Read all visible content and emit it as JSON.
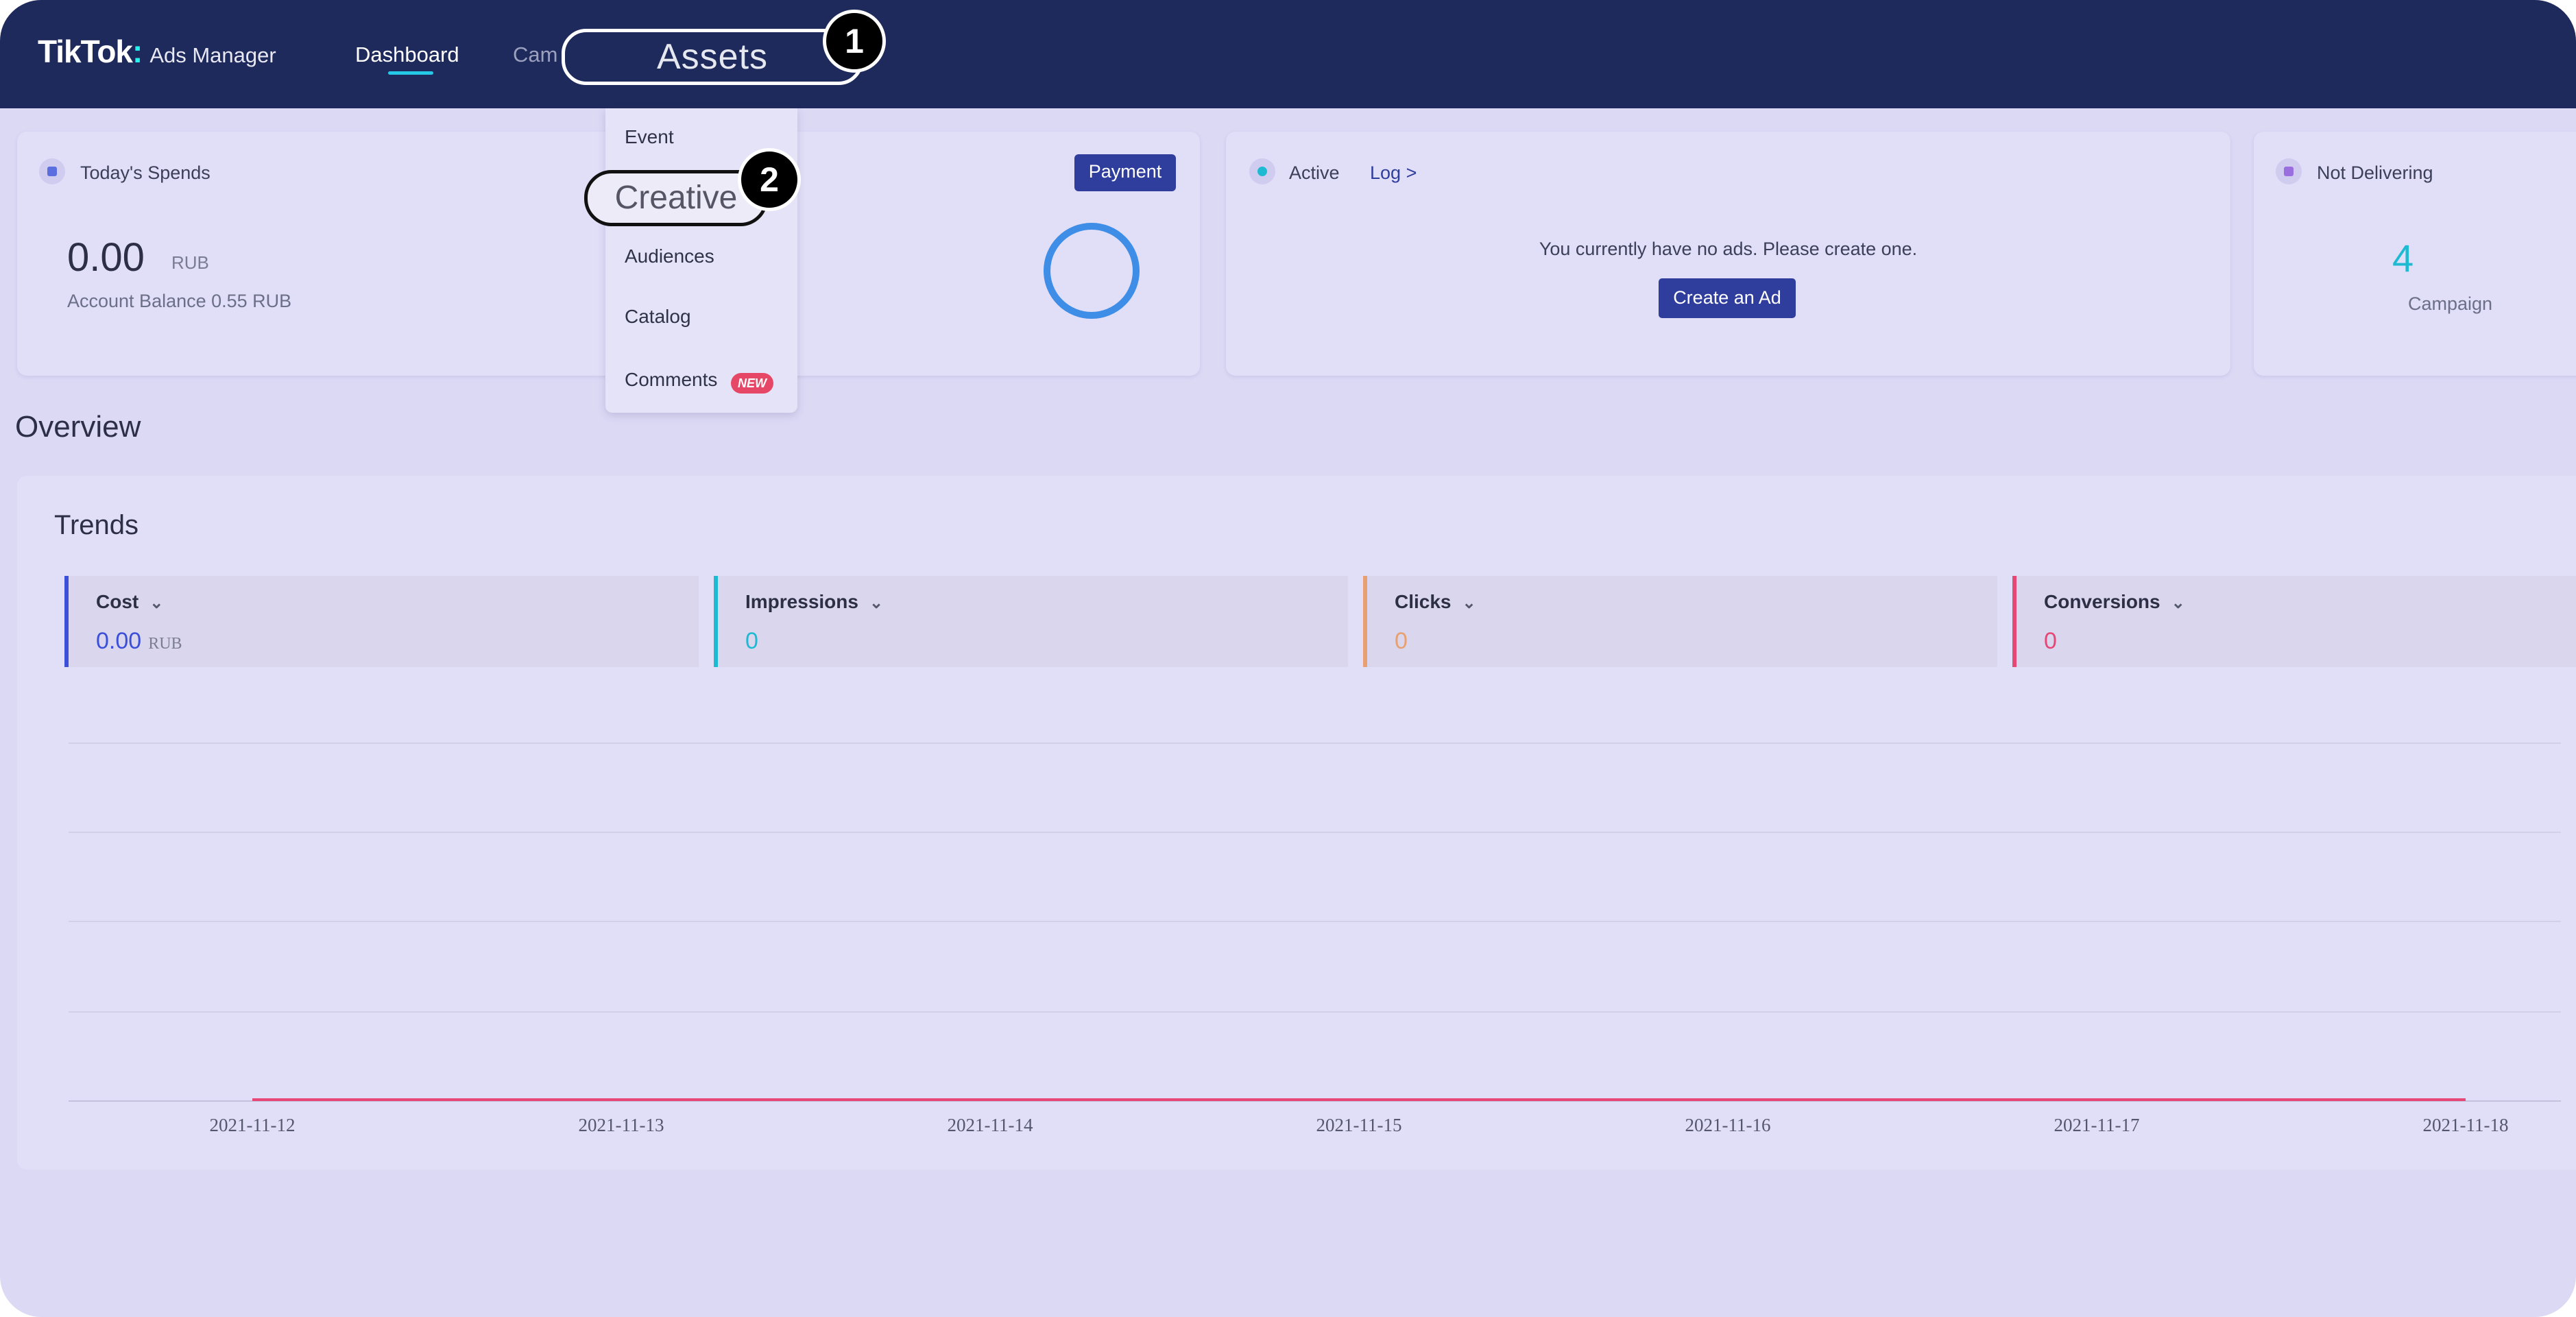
{
  "header": {
    "logo_brand": "TikTok",
    "logo_dot": ":",
    "logo_product": "Ads Manager",
    "nav": {
      "dashboard": "Dashboard",
      "campaign": "Cam",
      "assets": "Assets"
    }
  },
  "steps": {
    "one": "1",
    "two": "2"
  },
  "assets_menu": {
    "items": [
      "Event",
      "Creative",
      "Audiences",
      "Catalog",
      "Comments"
    ],
    "comments_badge": "NEW"
  },
  "spends_card": {
    "title": "Today's Spends",
    "value": "0.00",
    "unit": "RUB",
    "balance": "Account Balance 0.55 RUB",
    "payment_button": "Payment"
  },
  "active_card": {
    "status": "Active",
    "log_link": "Log",
    "log_chevron": ">",
    "empty_message": "You currently have no ads. Please create one.",
    "create_button": "Create an Ad"
  },
  "not_delivering_card": {
    "title": "Not Delivering",
    "count": "4",
    "label": "Campaign"
  },
  "overview": {
    "title": "Overview"
  },
  "trends": {
    "title": "Trends",
    "metrics": [
      {
        "label": "Cost",
        "value": "0.00",
        "unit": "RUB",
        "color": "#3b4fd8"
      },
      {
        "label": "Impressions",
        "value": "0",
        "unit": "",
        "color": "#1ebad2"
      },
      {
        "label": "Clicks",
        "value": "0",
        "unit": "",
        "color": "#e8a070"
      },
      {
        "label": "Conversions",
        "value": "0",
        "unit": "",
        "color": "#e74776"
      }
    ]
  },
  "chart_data": {
    "type": "line",
    "x": [
      "2021-11-12",
      "2021-11-13",
      "2021-11-14",
      "2021-11-15",
      "2021-11-16",
      "2021-11-17",
      "2021-11-18"
    ],
    "series": [
      {
        "values": [
          0,
          0,
          0,
          0,
          0,
          0,
          0
        ],
        "color": "#e74776"
      }
    ],
    "grid": true
  },
  "colors": {
    "topbar": "#1f2a5c",
    "primary_button": "#2f3e9c",
    "accent": "#25c9e6"
  }
}
